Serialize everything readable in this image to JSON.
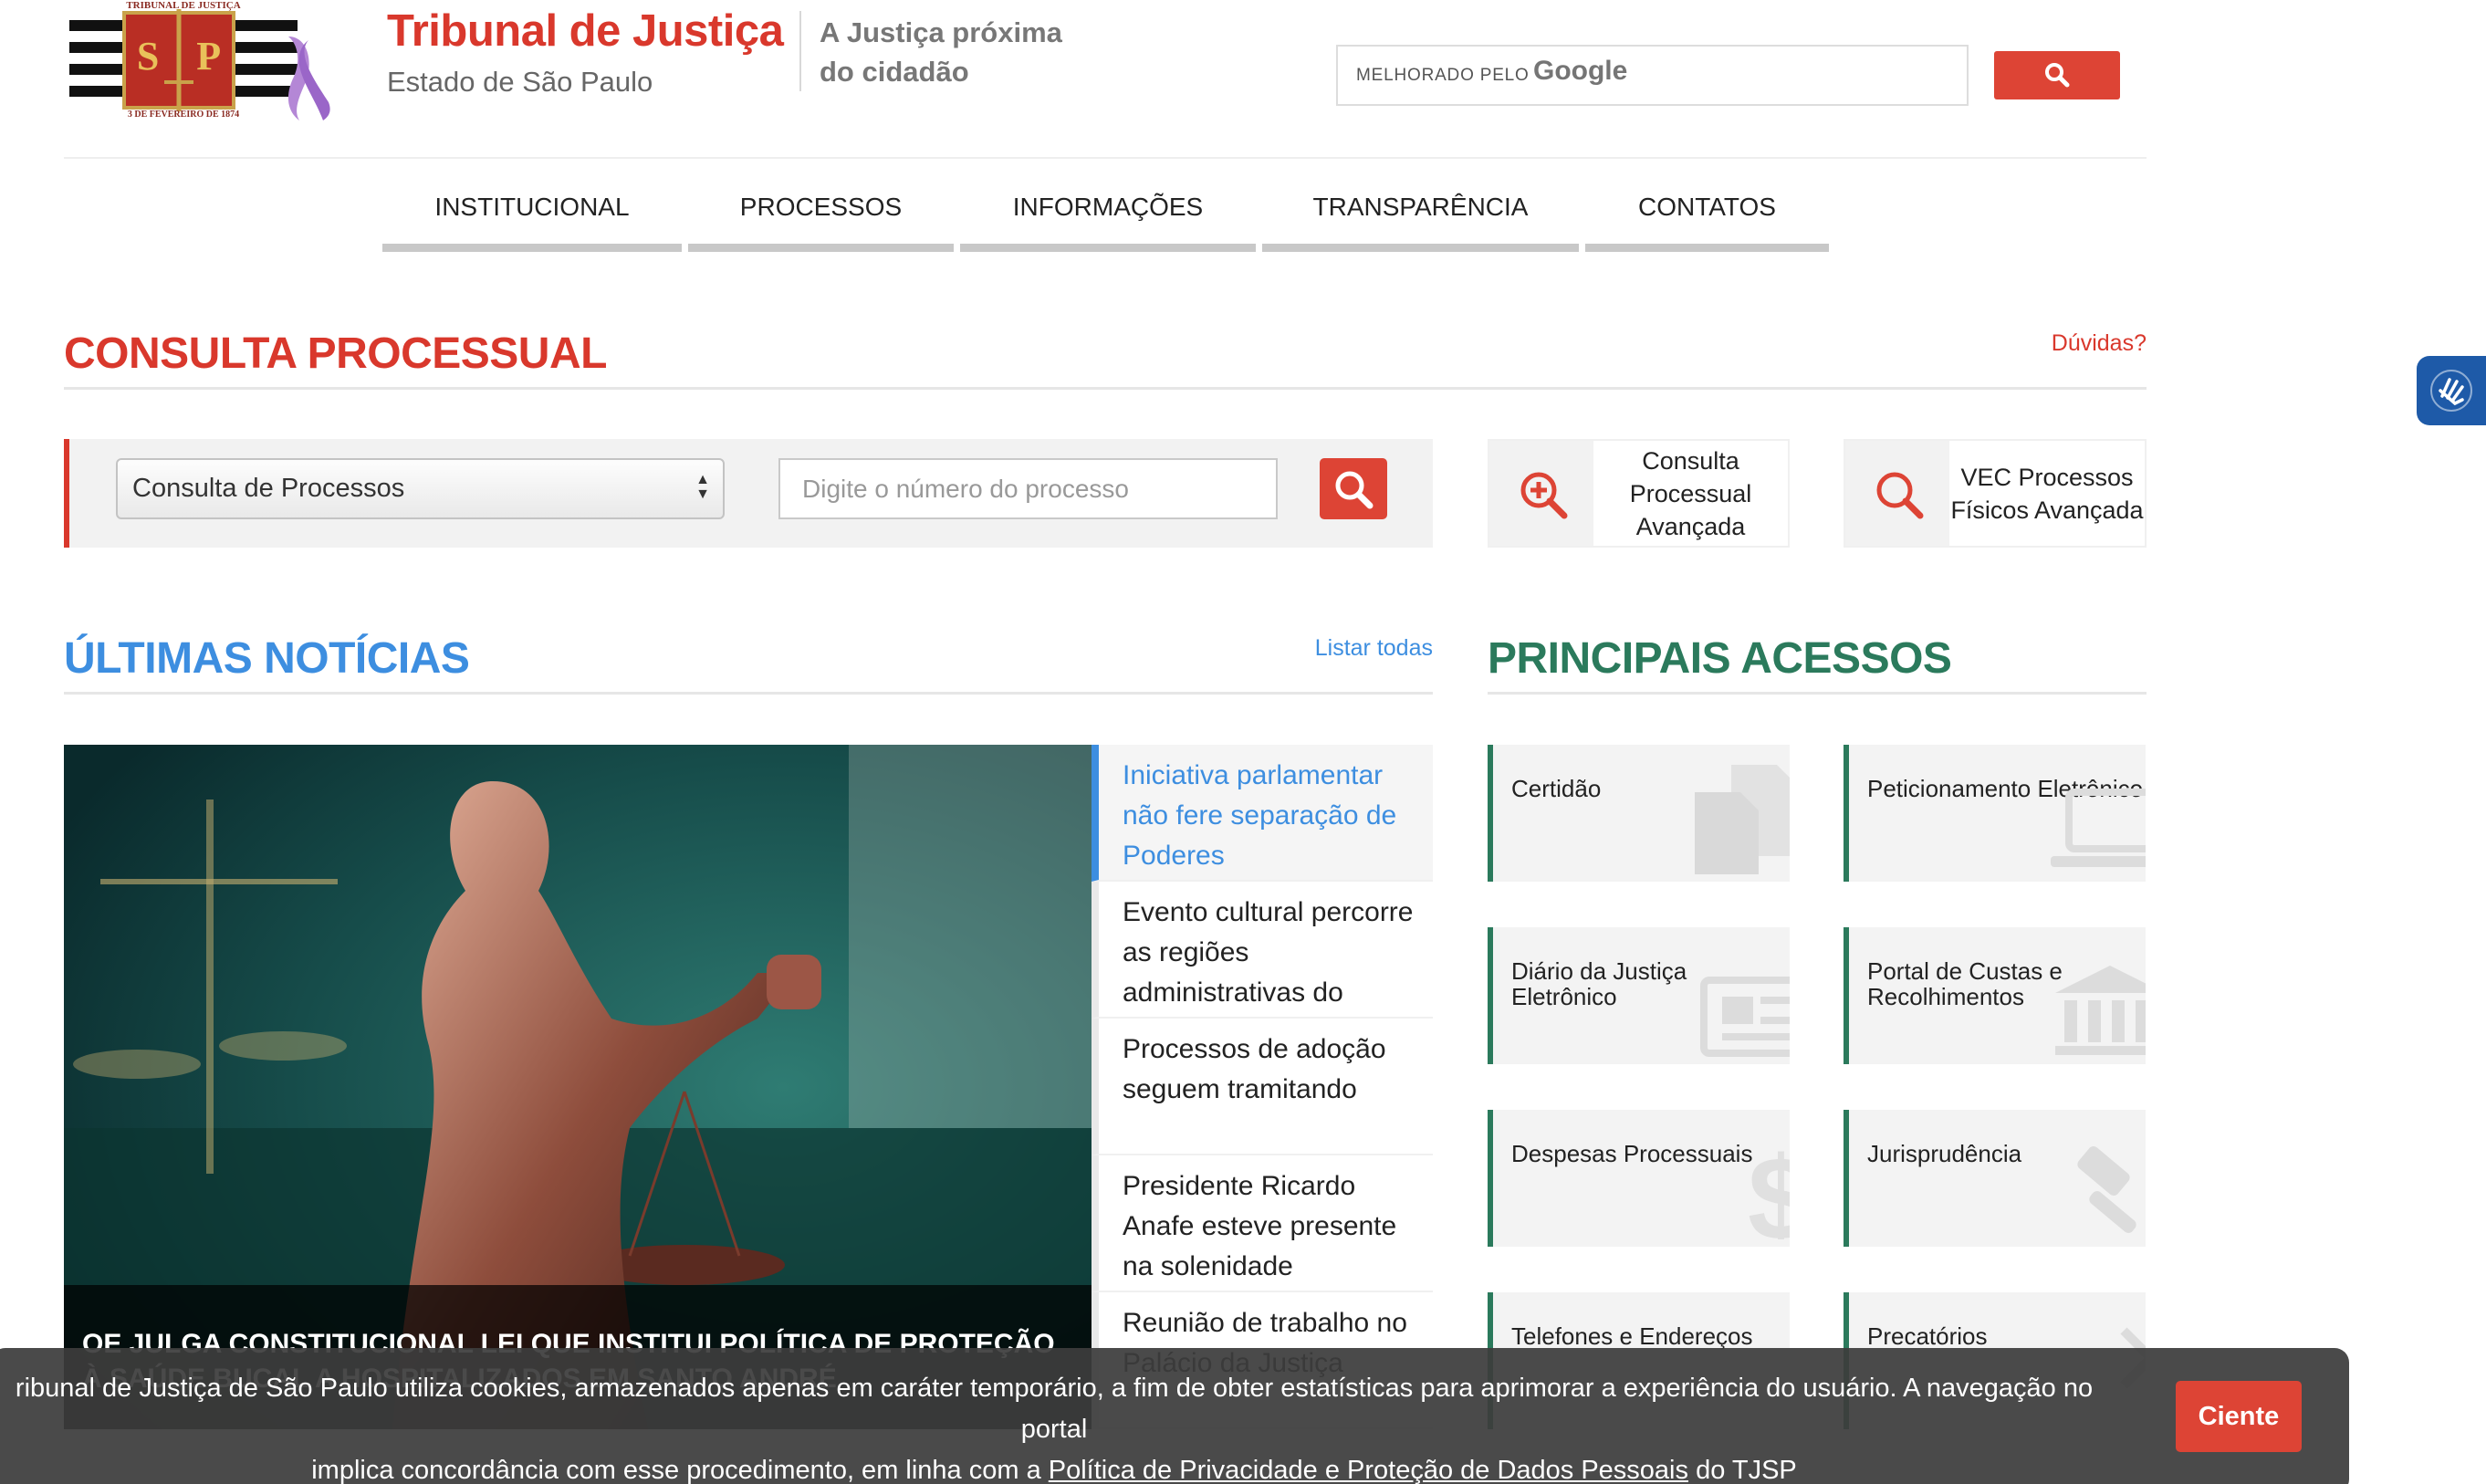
{
  "header": {
    "seal_text_top": "TRIBUNAL DE JUSTIÇA",
    "seal_letters": "S P",
    "seal_text_bottom": "3 DE FEVEREIRO DE 1874",
    "title": "Tribunal de Justiça",
    "subtitle": "Estado de São Paulo",
    "slogan_line1": "A Justiça próxima",
    "slogan_line2": "do cidadão",
    "search_prefix": "MELHORADO PELO",
    "search_brand": "Google",
    "search_icon": "search-icon"
  },
  "nav": {
    "items": [
      "INSTITUCIONAL",
      "PROCESSOS",
      "INFORMAÇÕES",
      "TRANSPARÊNCIA",
      "CONTATOS"
    ]
  },
  "consulta": {
    "title": "CONSULTA PROCESSUAL",
    "help_link": "Dúvidas?",
    "select_value": "Consulta de Processos",
    "input_placeholder": "Digite o número do processo",
    "search_icon": "search-icon",
    "quick_links": [
      {
        "label": "Consulta Processual Avançada",
        "icon": "zoom-in-icon"
      },
      {
        "label": "VEC Processos Físicos Avançada",
        "icon": "search-icon"
      }
    ]
  },
  "news": {
    "title": "ÚLTIMAS NOTÍCIAS",
    "list_all": "Listar todas",
    "hero_caption": "OE julga constitucional lei que institui política de proteção à saúde bucal a hospitalizados em Santo André",
    "items": [
      "Iniciativa parlamentar não fere separação de Poderes",
      "Evento cultural percorre as regiões administrativas do",
      "Processos de adoção seguem tramitando",
      "Presidente Ricardo Anafe esteve presente na solenidade",
      "Reunião de trabalho no Palácio da Justiça"
    ]
  },
  "access": {
    "title": "PRINCIPAIS ACESSOS",
    "tiles": [
      {
        "label": "Certidão",
        "icon": "document-copy-icon"
      },
      {
        "label": "Peticionamento Eletrônico",
        "icon": "laptop-icon"
      },
      {
        "label": "Diário da Justiça Eletrônico",
        "icon": "newspaper-icon"
      },
      {
        "label": "Portal de Custas e Recolhimentos",
        "icon": "bank-icon"
      },
      {
        "label": "Despesas Processuais",
        "icon": "dollar-icon"
      },
      {
        "label": "Jurisprudência",
        "icon": "gavel-icon"
      },
      {
        "label": "Telefones e Endereços",
        "icon": "phone-icon"
      },
      {
        "label": "Precatórios",
        "icon": "arrow-icon"
      }
    ]
  },
  "cookie": {
    "text_part1": "ribunal de Justiça de São Paulo utiliza cookies, armazenados apenas em caráter temporário, a fim de obter estatísticas para aprimorar a experiência do usuário. A navegação no portal",
    "text_part2": "implica concordância com esse procedimento, em linha com a",
    "link_text": "Política de Privacidade e Proteção de Dados Pessoais",
    "text_part3": "do TJSP",
    "button": "Ciente"
  },
  "colors": {
    "brand_red": "#d9382c",
    "news_blue": "#3d8ee0",
    "access_green": "#2b7a5c"
  }
}
